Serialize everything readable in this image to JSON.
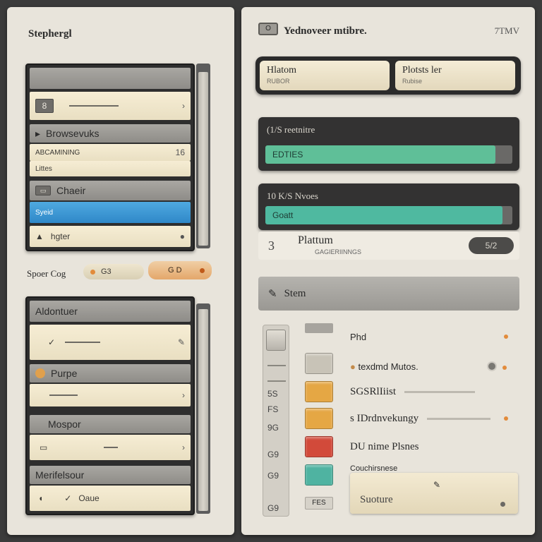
{
  "left": {
    "title": "Stephergl",
    "top_list": {
      "rows": [
        {
          "kind": "head",
          "label": ""
        },
        {
          "kind": "cream",
          "icon": "8",
          "label": ""
        },
        {
          "kind": "head",
          "label": "Browsevuks"
        },
        {
          "kind": "cream",
          "label": "ABCAMINING",
          "end": "16"
        },
        {
          "kind": "cream",
          "label": "Littes"
        },
        {
          "kind": "head",
          "label": "Chaeir"
        },
        {
          "kind": "blue",
          "label": "Syeid"
        },
        {
          "kind": "cream",
          "label": "hgter"
        }
      ]
    },
    "controls": {
      "label": "Spoer Cog",
      "pill_a": "G3",
      "pill_b": "G D"
    },
    "bottom_list": {
      "rows": [
        {
          "kind": "head",
          "label": "Aldontuer"
        },
        {
          "kind": "cream",
          "label": ""
        },
        {
          "kind": "head",
          "label": "Purpe"
        },
        {
          "kind": "cream",
          "label": ""
        },
        {
          "kind": "head",
          "label": "Mospor"
        },
        {
          "kind": "cream",
          "label": ""
        },
        {
          "kind": "head",
          "label": "Merifelsour"
        },
        {
          "kind": "cream",
          "label": "Oaue"
        }
      ]
    }
  },
  "right": {
    "badge": "O",
    "title": "Yednoveer mtibre.",
    "code": "7TMV",
    "toolbar": {
      "btn1": {
        "label": "Hlatom",
        "sub": "RUBOR"
      },
      "btn2": {
        "label": "Plotsts ler",
        "sub": "Rubise"
      }
    },
    "progress1": {
      "title": "(1/S reetnitre",
      "bar_text": "EDTIES",
      "fill": 0.93,
      "color": "#5fbf98"
    },
    "progress2": {
      "title": "10 K/S Nvoes",
      "bar_text": "Goatt",
      "fill": 0.96,
      "color": "#4fb9a0"
    },
    "info": {
      "num": "3",
      "main": "Plattum",
      "sub": "GAGIERIINNGS",
      "tag": "5/2"
    },
    "section": {
      "label": "Stem"
    },
    "scroll_labels": [
      "5S",
      "FS",
      "9G",
      "G9",
      "G9",
      "G9"
    ],
    "swatches": [
      {
        "color": "#c8c3b7"
      },
      {
        "color": "#e5a744"
      },
      {
        "color": "#e5a744"
      },
      {
        "color": "#d24a3a"
      },
      {
        "color": "#4fb3a1"
      }
    ],
    "swatch_foot": "FES",
    "options": [
      {
        "label": "Phd"
      },
      {
        "label": "texdmd Mutos."
      },
      {
        "label": "SGSRlIiist"
      },
      {
        "label": "s IDrdnvekungy"
      },
      {
        "label": "DU nime Plsnes"
      }
    ],
    "search": {
      "caption": "Couchirsnese",
      "placeholder": "Suoture"
    }
  }
}
